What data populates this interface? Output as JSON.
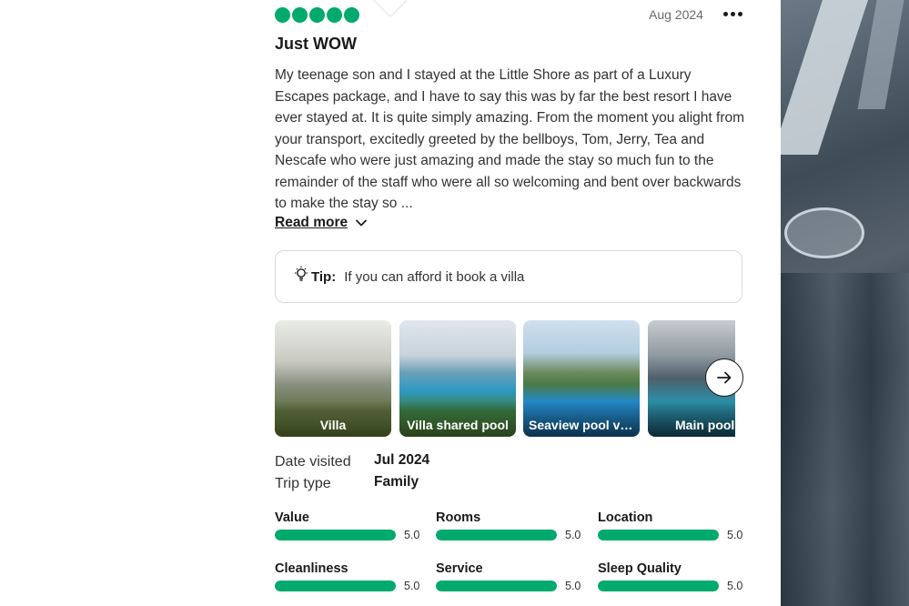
{
  "review": {
    "date": "Aug 2024",
    "rating_bubbles": 5,
    "title": "Just WOW",
    "body": "My teenage son and I stayed at the Little Shore as part of a Luxury Escapes package, and I have to say this was by far the best resort I have ever stayed at. It is quite simply amazing. From the moment you alight from your transport, excitedly greeted by the bellboys, Tom, Jerry, Tea and Nescafe who were just amazing and made the stay so much fun to the remainder of the staff who were all so welcoming and bent over backwards to make the stay so ...",
    "read_more": "Read more",
    "tip_label": "Tip:",
    "tip_text": "If you can afford it book a villa"
  },
  "photos": [
    {
      "caption": "Villa"
    },
    {
      "caption": "Villa shared pool"
    },
    {
      "caption": "Seaview pool villa"
    },
    {
      "caption": "Main pool"
    }
  ],
  "details": {
    "date_visited_label": "Date visited",
    "date_visited": "Jul 2024",
    "trip_type_label": "Trip type",
    "trip_type": "Family"
  },
  "ratings": [
    {
      "name": "Value",
      "score": "5.0",
      "fraction": 1.0
    },
    {
      "name": "Rooms",
      "score": "5.0",
      "fraction": 1.0
    },
    {
      "name": "Location",
      "score": "5.0",
      "fraction": 1.0
    },
    {
      "name": "Cleanliness",
      "score": "5.0",
      "fraction": 1.0
    },
    {
      "name": "Service",
      "score": "5.0",
      "fraction": 1.0
    },
    {
      "name": "Sleep Quality",
      "score": "5.0",
      "fraction": 1.0
    }
  ],
  "colors": {
    "accent": "#00aa6c",
    "text": "#1a1a1a"
  }
}
